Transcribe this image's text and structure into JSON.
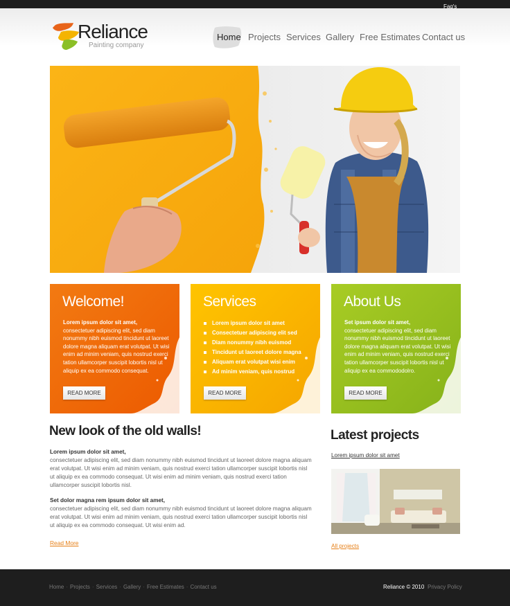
{
  "topbar": {
    "faq_label": "Faq's"
  },
  "brand": {
    "name": "Reliance",
    "tagline": "Painting company",
    "colors": {
      "orange": "#ec6a08",
      "yellow": "#ffc400",
      "green": "#97c11f",
      "dark": "#1e1e1e"
    }
  },
  "nav": {
    "items": [
      {
        "label": "Home",
        "active": true
      },
      {
        "label": "Projects"
      },
      {
        "label": "Services"
      },
      {
        "label": "Gallery"
      },
      {
        "label": "Free Estimates"
      },
      {
        "label": "Contact us"
      }
    ]
  },
  "boxes": {
    "welcome": {
      "title": "Welcome!",
      "lead": "Lorem ipsum dolor sit amet,",
      "body": "consectetuer adipiscing elit, sed diam nonummy nibh euismod tincidunt ut laoreet dolore magna aliquam erat volutpat. Ut wisi enim ad minim veniam, quis nostrud exerci tation ullamcorper suscipit lobortis nisl ut aliquip ex ea commodo consequat.",
      "button": "READ MORE"
    },
    "services": {
      "title": "Services",
      "items": [
        "Lorem ipsum dolor sit amet",
        "Consectetuer adipiscing elit sed",
        "Diam nonummy nibh euismod",
        "Tincidunt ut laoreet dolore magna",
        "Aliquam erat volutpat  wisi enim",
        "Ad minim veniam, quis nostrud"
      ],
      "button": "READ MORE"
    },
    "about": {
      "title": "About Us",
      "lead": "Set ipsum dolor sit amet,",
      "body": "consectetuer adipiscing elit, sed diam nonummy nibh euismod tincidunt ut laoreet dolore magna aliquam erat volutpat. Ut wisi enim ad minim veniam, quis nostrud exerci tation ullamcorper suscipit lobortis nisl ut aliquip ex ea commododolro.",
      "button": "READ MORE"
    }
  },
  "main": {
    "title": "New look of the old walls!",
    "para1_lead": "Lorem ipsum dolor sit amet,",
    "para1_body": "consectetuer adipiscing elit, sed diam nonummy nibh euismod tincidunt ut laoreet dolore magna aliquam erat volutpat. Ut wisi enim ad minim veniam, quis nostrud exerci tation ullamcorper suscipit lobortis nisl ut aliquip ex ea commodo consequat. Ut wisi enim ad minim veniam, quis nostrud exerci tation ullamcorper suscipit lobortis nisl.",
    "para2_lead": "Set dolor magna rem ipsum dolor sit amet,",
    "para2_body": "consectetuer adipiscing elit, sed diam nonummy nibh euismod tincidunt ut laoreet dolore magna aliquam erat volutpat. Ut wisi enim ad minim veniam, quis nostrud exerci tation ullamcorper suscipit lobortis nisl ut aliquip ex ea commodo consequat. Ut wisi enim ad.",
    "read_more": "Read More"
  },
  "sidebar": {
    "title": "Latest projects",
    "link": "Lorem ipsum dolor sit amet",
    "all_projects": "All projects"
  },
  "footer": {
    "nav": [
      "Home",
      "Projects",
      "Services",
      "Gallery",
      "Free Estimates",
      "Contact us"
    ],
    "copyright": "Reliance © 2010",
    "privacy": "Privacy Policy"
  }
}
